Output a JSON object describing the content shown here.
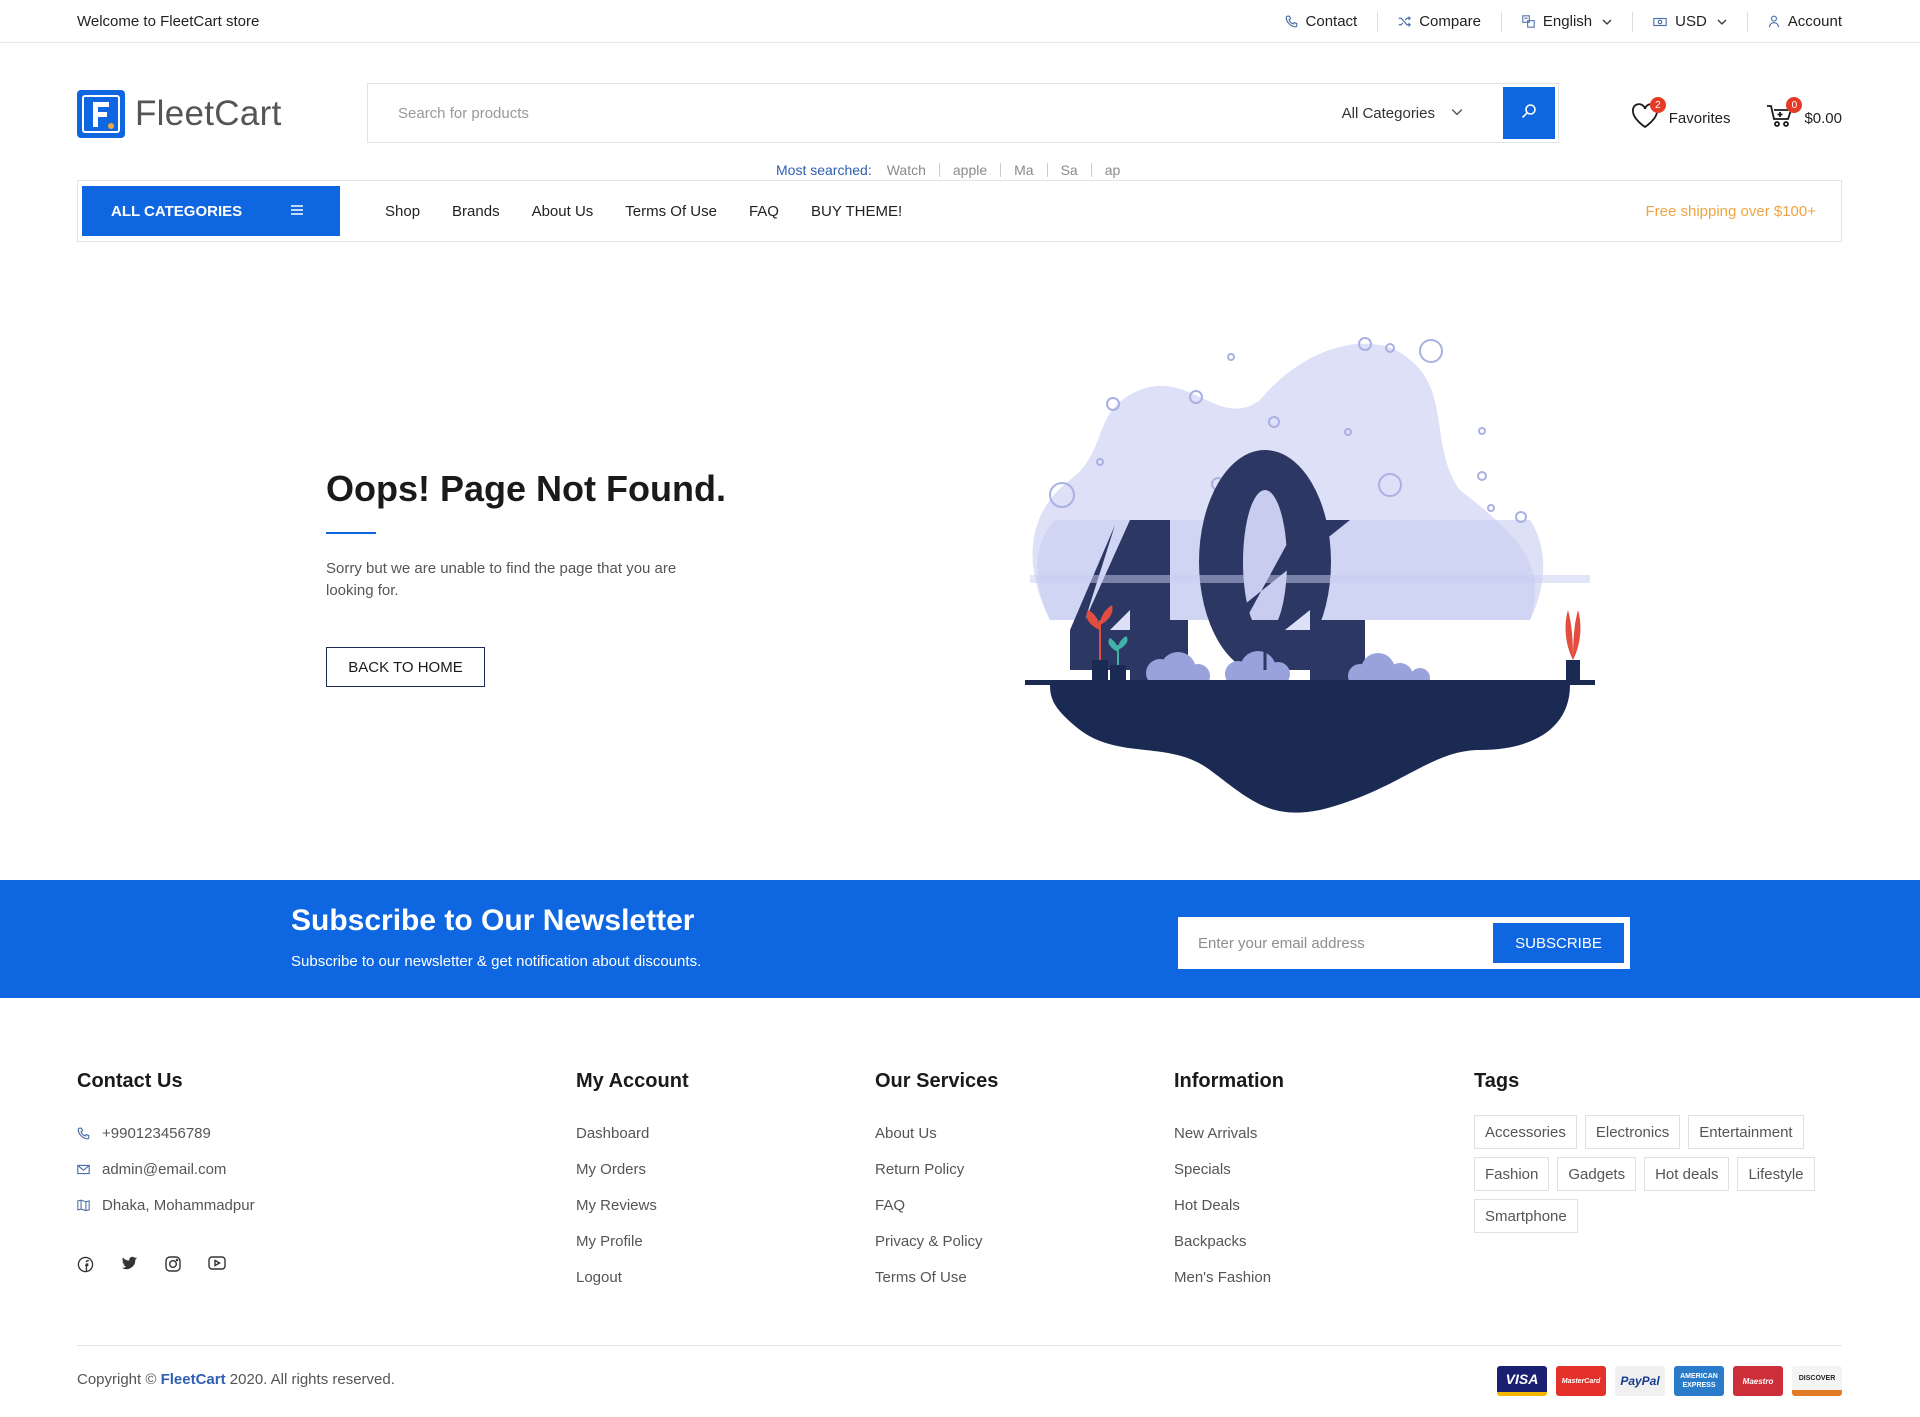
{
  "topbar": {
    "welcome": "Welcome to FleetCart store",
    "links": {
      "contact": "Contact",
      "compare": "Compare",
      "language": "English",
      "currency": "USD",
      "account": "Account"
    }
  },
  "header": {
    "logo_text": "FleetCart",
    "search_placeholder": "Search for products",
    "category_select": "All Categories",
    "most_searched_label": "Most searched:",
    "most_searched": [
      "Watch",
      "apple",
      "Ma",
      "Sa",
      "ap"
    ],
    "favorites_label": "Favorites",
    "favorites_count": "2",
    "cart_count": "0",
    "cart_total": "$0.00"
  },
  "nav": {
    "all_categories": "ALL CATEGORIES",
    "menu": [
      "Shop",
      "Brands",
      "About Us",
      "Terms Of Use",
      "FAQ",
      "BUY THEME!"
    ],
    "free_shipping": "Free shipping over $100+"
  },
  "error": {
    "title": "Oops! Page Not Found.",
    "message": "Sorry but we are unable to find the page that you are looking for.",
    "button": "BACK TO HOME",
    "code": "404"
  },
  "newsletter": {
    "title": "Subscribe to Our Newsletter",
    "subtitle": "Subscribe to our newsletter & get notification about discounts.",
    "placeholder": "Enter your email address",
    "button": "SUBSCRIBE"
  },
  "footer": {
    "contact": {
      "title": "Contact Us",
      "phone": "+990123456789",
      "email": "admin@email.com",
      "address": "Dhaka, Mohammadpur"
    },
    "my_account": {
      "title": "My Account",
      "items": [
        "Dashboard",
        "My Orders",
        "My Reviews",
        "My Profile",
        "Logout"
      ]
    },
    "services": {
      "title": "Our Services",
      "items": [
        "About Us",
        "Return Policy",
        "FAQ",
        "Privacy & Policy",
        "Terms Of Use"
      ]
    },
    "information": {
      "title": "Information",
      "items": [
        "New Arrivals",
        "Specials",
        "Hot Deals",
        "Backpacks",
        "Men's Fashion"
      ]
    },
    "tags": {
      "title": "Tags",
      "items": [
        "Accessories",
        "Electronics",
        "Entertainment",
        "Fashion",
        "Gadgets",
        "Hot deals",
        "Lifestyle",
        "Smartphone"
      ]
    },
    "copyright_prefix": "Copyright ©",
    "copyright_brand": "FleetCart",
    "copyright_suffix": "2020. All rights reserved.",
    "payments": [
      "VISA",
      "MasterCard",
      "PayPal",
      "AMERICAN EXPRESS",
      "Maestro",
      "DISCOVER"
    ]
  },
  "colors": {
    "primary": "#0e67e0",
    "navy": "#1b2a52",
    "accent": "#eea544",
    "badge": "#e53a26"
  }
}
